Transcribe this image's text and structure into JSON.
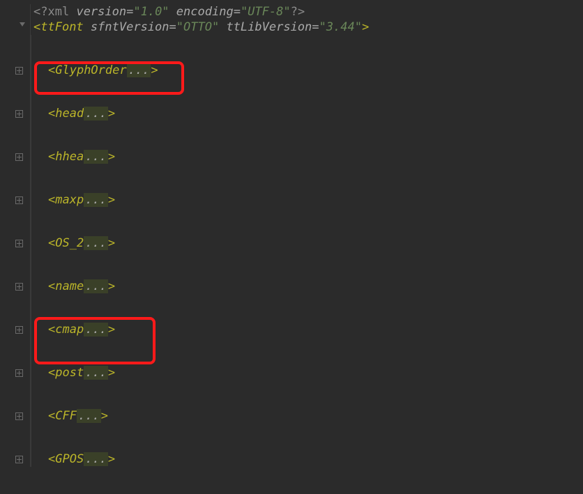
{
  "xml_decl": {
    "open": "<?",
    "name": "xml",
    "attrs": [
      {
        "k": "version",
        "v": "\"1.0\""
      },
      {
        "k": "encoding",
        "v": "\"UTF-8\""
      }
    ],
    "close": "?>"
  },
  "root": {
    "open": "<",
    "name": "ttFont",
    "attrs": [
      {
        "k": "sfntVersion",
        "v": "\"OTTO\""
      },
      {
        "k": "ttLibVersion",
        "v": "\"3.44\""
      }
    ],
    "close": ">"
  },
  "nodes": [
    {
      "tag": "GlyphOrder",
      "ell": "...",
      "highlight": true
    },
    {
      "tag": "head",
      "ell": "..."
    },
    {
      "tag": "hhea",
      "ell": "..."
    },
    {
      "tag": "maxp",
      "ell": "..."
    },
    {
      "tag": "OS_2",
      "ell": "..."
    },
    {
      "tag": "name",
      "ell": "..."
    },
    {
      "tag": "cmap",
      "ell": "...",
      "highlight": true
    },
    {
      "tag": "post",
      "ell": "..."
    },
    {
      "tag": "CFF",
      "ell": "..."
    },
    {
      "tag": "GPOS",
      "ell": "..."
    }
  ]
}
